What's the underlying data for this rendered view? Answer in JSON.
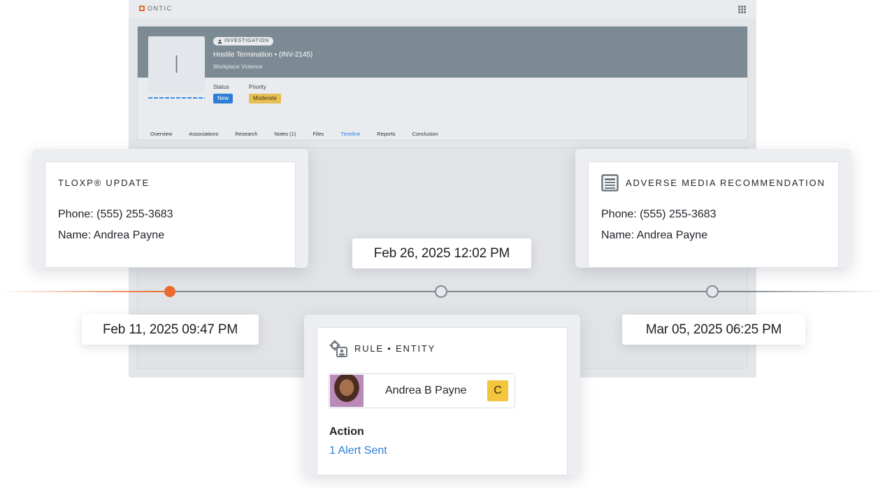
{
  "app": {
    "brand": "ONTIC",
    "icons": {
      "brand": "ontic-logo-icon",
      "apps": "app-grid-icon"
    }
  },
  "case": {
    "avatar_letter": "I",
    "badge": "INVESTIGATION",
    "title": "Hostile Termination • (INV-2145)",
    "subtitle": "Workplace Violence",
    "status_label": "Status",
    "status_value": "New",
    "priority_label": "Priority",
    "priority_value": "Moderate"
  },
  "tabs": [
    {
      "label": "Overview",
      "active": false
    },
    {
      "label": "Associations",
      "active": false
    },
    {
      "label": "Research",
      "active": false
    },
    {
      "label": "Notes (1)",
      "active": false
    },
    {
      "label": "Files",
      "active": false
    },
    {
      "label": "Timeline",
      "active": true
    },
    {
      "label": "Reports",
      "active": false
    },
    {
      "label": "Conclusion",
      "active": false
    }
  ],
  "timeline": {
    "dates": [
      "Feb 11, 2025 09:47 PM",
      "Feb 26, 2025 12:02 PM",
      "Mar 05, 2025 06:25 PM"
    ],
    "colors": {
      "past": "#e86a2d",
      "future": "#7f8990"
    }
  },
  "events": {
    "tloxp": {
      "title": "TLOXP® UPDATE",
      "phone": "Phone: (555) 255-3683",
      "name": "Name: Andrea Payne"
    },
    "adverse": {
      "title": "ADVERSE MEDIA RECOMMENDATION",
      "icon": "news-article-icon",
      "phone": "Phone: (555) 255-3683",
      "name": "Name: Andrea Payne"
    },
    "rule": {
      "title": "RULE • ENTITY",
      "icon": "rule-entity-icon",
      "entity_name": "Andrea B Payne",
      "entity_badge": "C",
      "action_label": "Action",
      "action_value": "1 Alert Sent"
    }
  }
}
